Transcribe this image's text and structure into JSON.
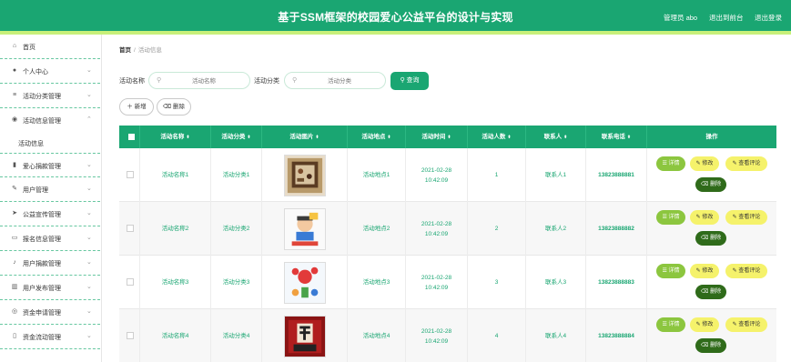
{
  "header": {
    "title": "基于SSM框架的校园爱心公益平台的设计与实现",
    "user": "管理员 abo",
    "back_front": "退出到前台",
    "logout": "退出登录"
  },
  "sidebar": {
    "items": [
      {
        "label": "首页",
        "icon": "home-icon",
        "glyph": "⌂",
        "arrow": ""
      },
      {
        "label": "个人中心",
        "icon": "user-icon",
        "glyph": "●",
        "arrow": "⌄"
      },
      {
        "label": "活动分类管理",
        "icon": "list-icon",
        "glyph": "≡",
        "arrow": "⌄"
      },
      {
        "label": "活动信息管理",
        "icon": "location-icon",
        "glyph": "◉",
        "arrow": "⌃"
      },
      {
        "label": "爱心捐款管理",
        "icon": "bar-chart-icon",
        "glyph": "▮",
        "arrow": "⌄"
      },
      {
        "label": "用户管理",
        "icon": "edit-icon",
        "glyph": "✎",
        "arrow": "⌄"
      },
      {
        "label": "公益宣传管理",
        "icon": "send-icon",
        "glyph": "➤",
        "arrow": "⌄"
      },
      {
        "label": "报名信息管理",
        "icon": "message-icon",
        "glyph": "▭",
        "arrow": "⌄"
      },
      {
        "label": "用户捐款管理",
        "icon": "microphone-icon",
        "glyph": "♪",
        "arrow": "⌄"
      },
      {
        "label": "用户发布管理",
        "icon": "building-icon",
        "glyph": "▥",
        "arrow": "⌄"
      },
      {
        "label": "资金申请管理",
        "icon": "compass-icon",
        "glyph": "◎",
        "arrow": "⌄"
      },
      {
        "label": "资金流动管理",
        "icon": "phone-icon",
        "glyph": "▯",
        "arrow": "⌄"
      }
    ],
    "sub_item": "活动信息"
  },
  "breadcrumb": {
    "home": "首页",
    "separator": "/",
    "current": "活动信息"
  },
  "search": {
    "name_label": "活动名称",
    "name_placeholder": "活动名称",
    "category_label": "活动分类",
    "category_placeholder": "活动分类",
    "query_button": "查询",
    "search_glyph": "⚲"
  },
  "actions": {
    "add": "新增",
    "delete": "删除"
  },
  "table": {
    "columns": [
      "活动名称",
      "活动分类",
      "活动图片",
      "活动地点",
      "活动时间",
      "活动人数",
      "联系人",
      "联系电话",
      "操作"
    ],
    "sort_glyph": "⬍",
    "rows": [
      {
        "name": "活动名称1",
        "category": "活动分类1",
        "place": "活动地点1",
        "time": "2021-02-28 10:42:09",
        "count": "1",
        "contact": "联系人1",
        "phone": "13823888881"
      },
      {
        "name": "活动名称2",
        "category": "活动分类2",
        "place": "活动地点2",
        "time": "2021-02-28 10:42:09",
        "count": "2",
        "contact": "联系人2",
        "phone": "13823888882"
      },
      {
        "name": "活动名称3",
        "category": "活动分类3",
        "place": "活动地点3",
        "time": "2021-02-28 10:42:09",
        "count": "3",
        "contact": "联系人3",
        "phone": "13823888883"
      },
      {
        "name": "活动名称4",
        "category": "活动分类4",
        "place": "活动地点4",
        "time": "2021-02-28 10:42:09",
        "count": "4",
        "contact": "联系人4",
        "phone": "13823888884"
      }
    ],
    "ops": {
      "detail": "详情",
      "edit": "修改",
      "comment": "查看评论",
      "delete": "删除"
    }
  },
  "colors": {
    "primary": "#1aa672",
    "accent_yellow": "#f5f26b",
    "detail_green": "#8cc63f",
    "delete_dark": "#2f6b1a",
    "stripe": "#c8f07a"
  }
}
